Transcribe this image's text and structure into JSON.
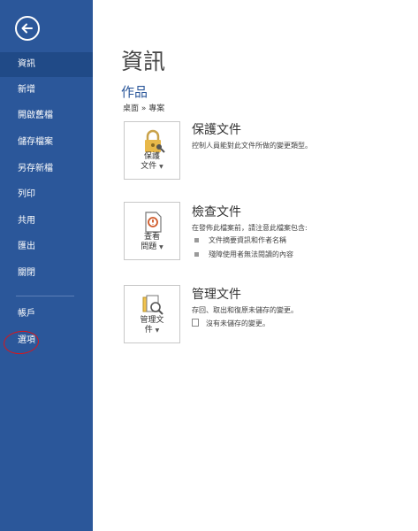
{
  "sidebar": {
    "items": [
      {
        "label": "資訊",
        "active": true
      },
      {
        "label": "新增"
      },
      {
        "label": "開啟舊檔"
      },
      {
        "label": "儲存檔案"
      },
      {
        "label": "另存新檔"
      },
      {
        "label": "列印"
      },
      {
        "label": "共用"
      },
      {
        "label": "匯出"
      },
      {
        "label": "關閉"
      }
    ],
    "bottom_items": [
      {
        "label": "帳戶"
      },
      {
        "label": "選項",
        "annotated": true
      }
    ]
  },
  "main": {
    "title": "資訊",
    "document_name": "作品",
    "document_path": "桌面 » 專案",
    "sections": [
      {
        "button_label_line1": "保護",
        "button_label_line2": "文件",
        "title": "保護文件",
        "description": "控制人員能對此文件所做的變更類型。"
      },
      {
        "button_label_line1": "查看",
        "button_label_line2": "問題",
        "title": "檢查文件",
        "description": "在發佈此檔案前，請注意此檔案包含:",
        "bullets": [
          "文件摘要資訊和作者名稱",
          "殘障使用者無法閱讀的內容"
        ]
      },
      {
        "button_label_line1": "管理文",
        "button_label_line2": "件",
        "title": "管理文件",
        "description": "存回、取出和復原未儲存的變更。",
        "note": "沒有未儲存的變更。"
      }
    ]
  },
  "colors": {
    "sidebar_bg": "#2b579a",
    "sidebar_active": "#204a87",
    "accent": "#2b579a",
    "annotation_red": "#d9161b"
  }
}
